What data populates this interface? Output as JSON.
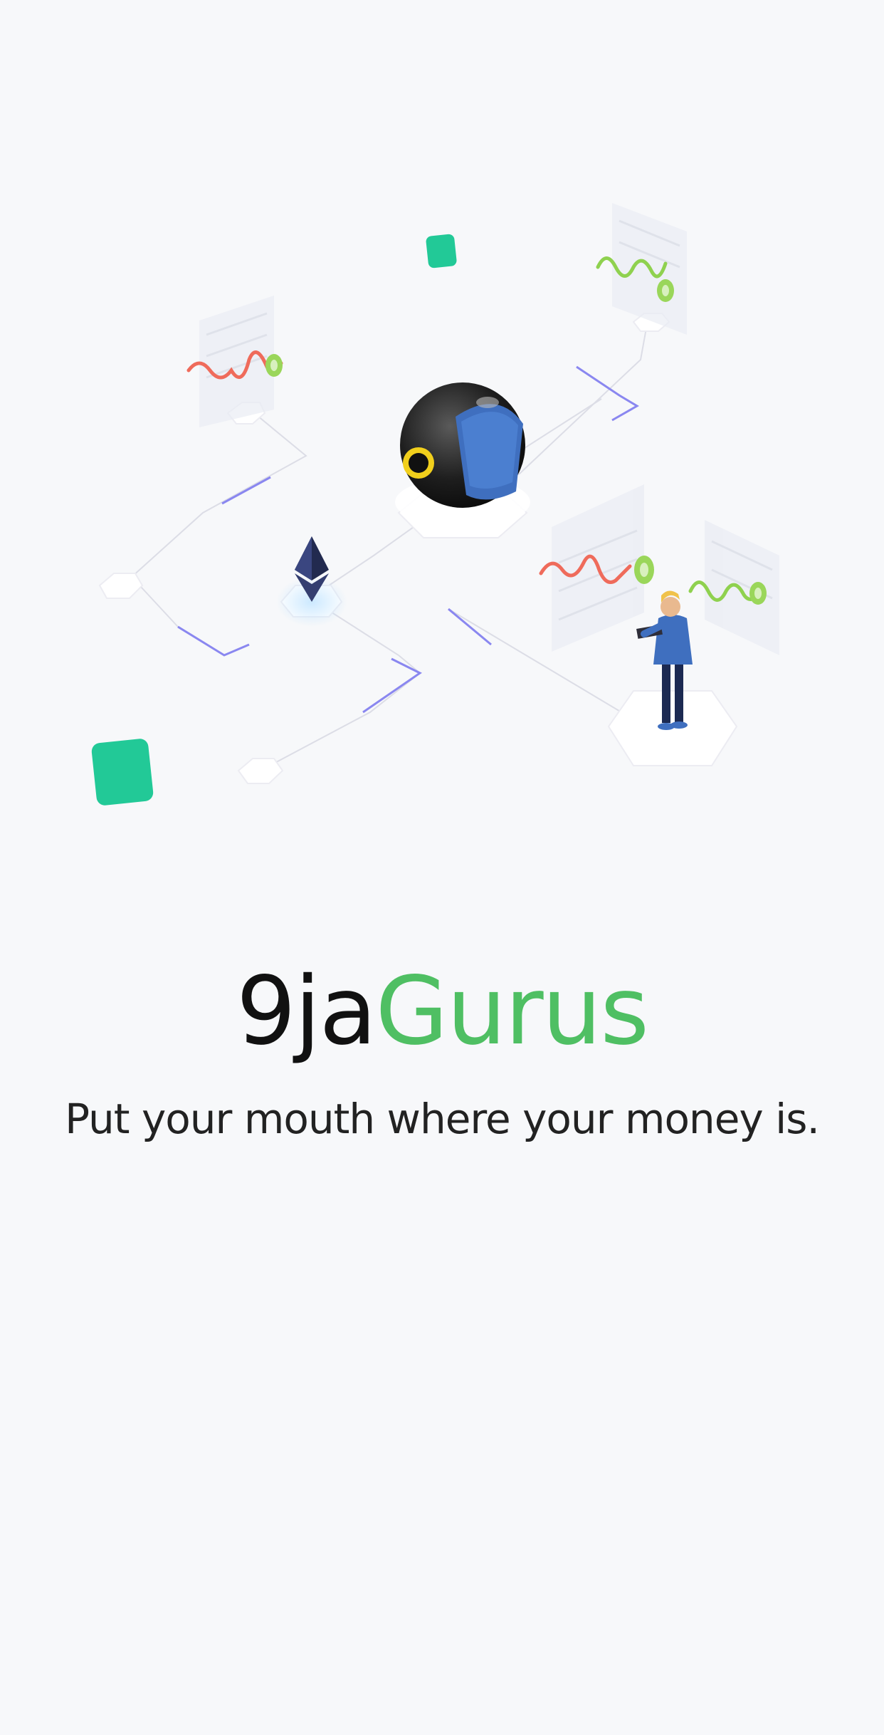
{
  "app": {
    "brand_part1": "9ja",
    "brand_part2": "Gurus",
    "tagline": "Put your mouth where your money is."
  },
  "colors": {
    "background": "#f7f8fa",
    "brand_dark": "#111111",
    "brand_green": "#4fbf63",
    "accent_teal": "#22c997",
    "accent_blue": "#3f6fbf",
    "wave_red": "#ef6b5b",
    "wave_green": "#8fd14f",
    "line_purple": "#8a87f0"
  },
  "icons": {
    "hero": "blockchain-network-illustration",
    "token": "ethereum-icon",
    "node": "crypto-orb-icon",
    "person": "person-with-tablet-icon"
  }
}
